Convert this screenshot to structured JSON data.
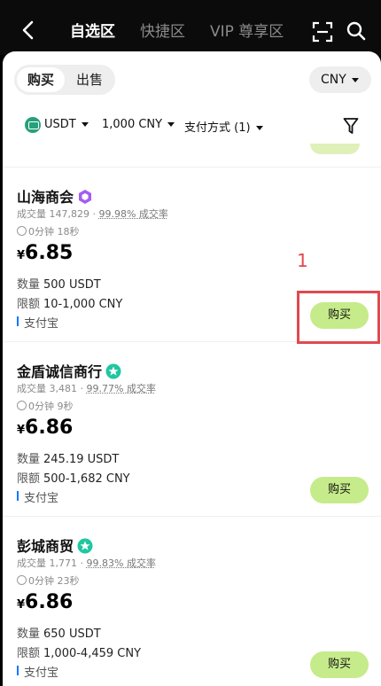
{
  "header": {
    "tabs": [
      {
        "label": "自选区",
        "active": true
      },
      {
        "label": "快捷区",
        "active": false
      },
      {
        "label": "VIP 尊享区",
        "active": false
      }
    ]
  },
  "toggle": {
    "buy": "购买",
    "sell": "出售"
  },
  "currency": "CNY",
  "filters": {
    "coin": "USDT",
    "amount": "1,000 CNY",
    "payment": "支付方式 (1)"
  },
  "merchants": [
    {
      "name": "山海商会",
      "badge_color": "#a35df2",
      "volume": "成交量 147,829",
      "rate": "99.98% 成交率",
      "time": "0分钟 18秒",
      "currency_symbol": "¥",
      "price": "6.85",
      "qty_label": "数量",
      "qty": "500 USDT",
      "limit_label": "限额",
      "limit": "10-1,000 CNY",
      "payment": "支付宝",
      "buy_label": "购买"
    },
    {
      "name": "金盾诚信商行",
      "badge_color": "#1fc7a0",
      "volume": "成交量 3,481",
      "rate": "99.77% 成交率",
      "time": "0分钟 9秒",
      "currency_symbol": "¥",
      "price": "6.86",
      "qty_label": "数量",
      "qty": "245.19 USDT",
      "limit_label": "限额",
      "limit": "500-1,682 CNY",
      "payment": "支付宝",
      "buy_label": "购买"
    },
    {
      "name": "彭城商贸",
      "badge_color": "#1fc7a0",
      "volume": "成交量 1,771",
      "rate": "99.83% 成交率",
      "time": "0分钟 23秒",
      "currency_symbol": "¥",
      "price": "6.86",
      "qty_label": "数量",
      "qty": "650 USDT",
      "limit_label": "限额",
      "limit": "1,000-4,459 CNY",
      "payment": "支付宝",
      "buy_label": "购买"
    }
  ],
  "annotation": {
    "label": "1",
    "color": "#e0494e"
  }
}
